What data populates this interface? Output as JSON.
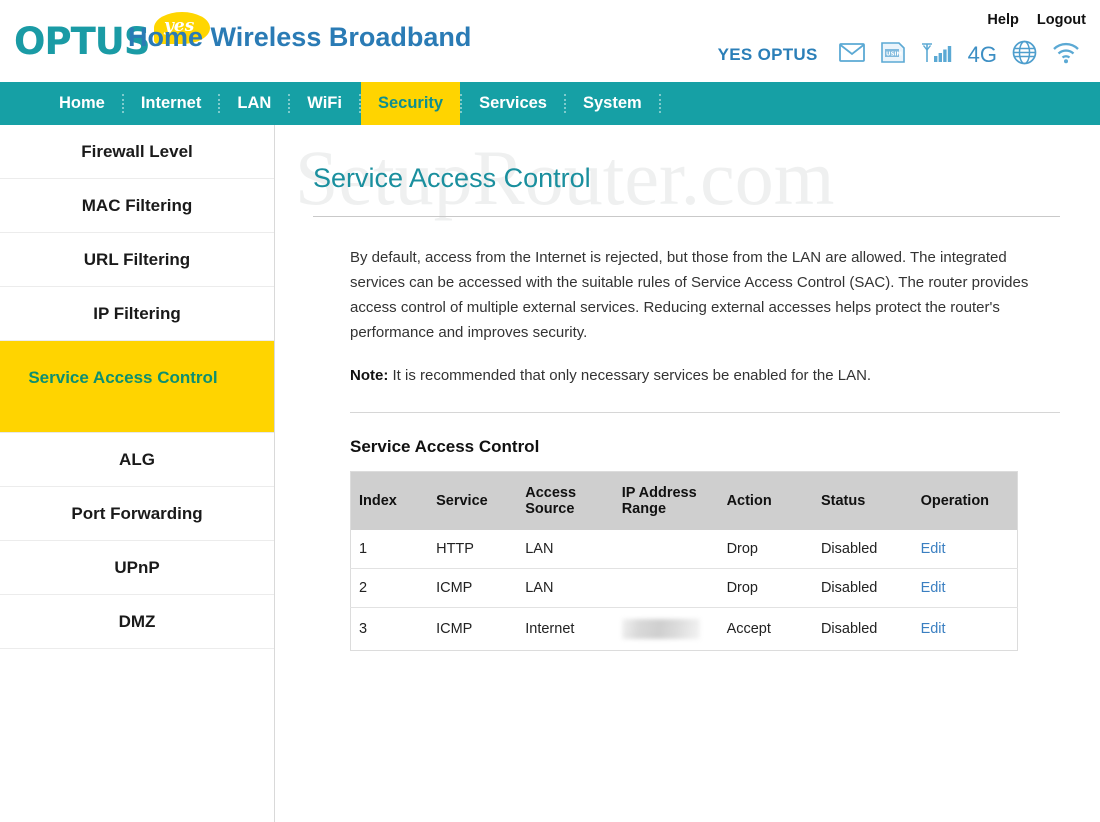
{
  "header": {
    "logo_text": "OPTUS",
    "logo_bubble_text": "yes",
    "product_title": "Home Wireless Broadband",
    "help_label": "Help",
    "logout_label": "Logout",
    "carrier_label": "YES OPTUS",
    "network_label": "4G",
    "usim_label": "USIM",
    "icons": [
      "mail-icon",
      "usim-icon",
      "signal-icon",
      "globe-icon",
      "wifi-icon"
    ]
  },
  "nav": {
    "items": [
      {
        "label": "Home",
        "active": false
      },
      {
        "label": "Internet",
        "active": false
      },
      {
        "label": "LAN",
        "active": false
      },
      {
        "label": "WiFi",
        "active": false
      },
      {
        "label": "Security",
        "active": true
      },
      {
        "label": "Services",
        "active": false
      },
      {
        "label": "System",
        "active": false
      }
    ]
  },
  "sidebar": {
    "items": [
      {
        "label": "Firewall Level",
        "active": false
      },
      {
        "label": "MAC Filtering",
        "active": false
      },
      {
        "label": "URL Filtering",
        "active": false
      },
      {
        "label": "IP Filtering",
        "active": false
      },
      {
        "label": "Service Access Control",
        "active": true
      },
      {
        "label": "ALG",
        "active": false
      },
      {
        "label": "Port Forwarding",
        "active": false
      },
      {
        "label": "UPnP",
        "active": false
      },
      {
        "label": "DMZ",
        "active": false
      }
    ]
  },
  "main": {
    "watermark": "SetupRouter.com",
    "page_title": "Service Access Control",
    "description": "By default, access from the Internet is rejected, but those from the LAN are allowed. The integrated services can be accessed with the suitable rules of Service Access Control (SAC). The router provides access control of multiple external services. Reducing external accesses helps protect the router's performance and improves security.",
    "note_label": "Note:",
    "note_text": " It is recommended that only necessary services be enabled for the LAN.",
    "section_title": "Service Access Control",
    "table": {
      "headers": [
        "Index",
        "Service",
        "Access Source",
        "IP Address Range",
        "Action",
        "Status",
        "Operation"
      ],
      "rows": [
        {
          "index": "1",
          "service": "HTTP",
          "source": "LAN",
          "range": "",
          "range_blurred": false,
          "action": "Drop",
          "status": "Disabled",
          "operation": "Edit"
        },
        {
          "index": "2",
          "service": "ICMP",
          "source": "LAN",
          "range": "",
          "range_blurred": false,
          "action": "Drop",
          "status": "Disabled",
          "operation": "Edit"
        },
        {
          "index": "3",
          "service": "ICMP",
          "source": "Internet",
          "range": "",
          "range_blurred": true,
          "action": "Accept",
          "status": "Disabled",
          "operation": "Edit"
        }
      ]
    }
  },
  "colors": {
    "teal": "#16a0a5",
    "yellow": "#ffd400",
    "title_teal": "#1a8f9e",
    "link_blue": "#3a7fc1",
    "product_blue": "#2a7bb5"
  }
}
